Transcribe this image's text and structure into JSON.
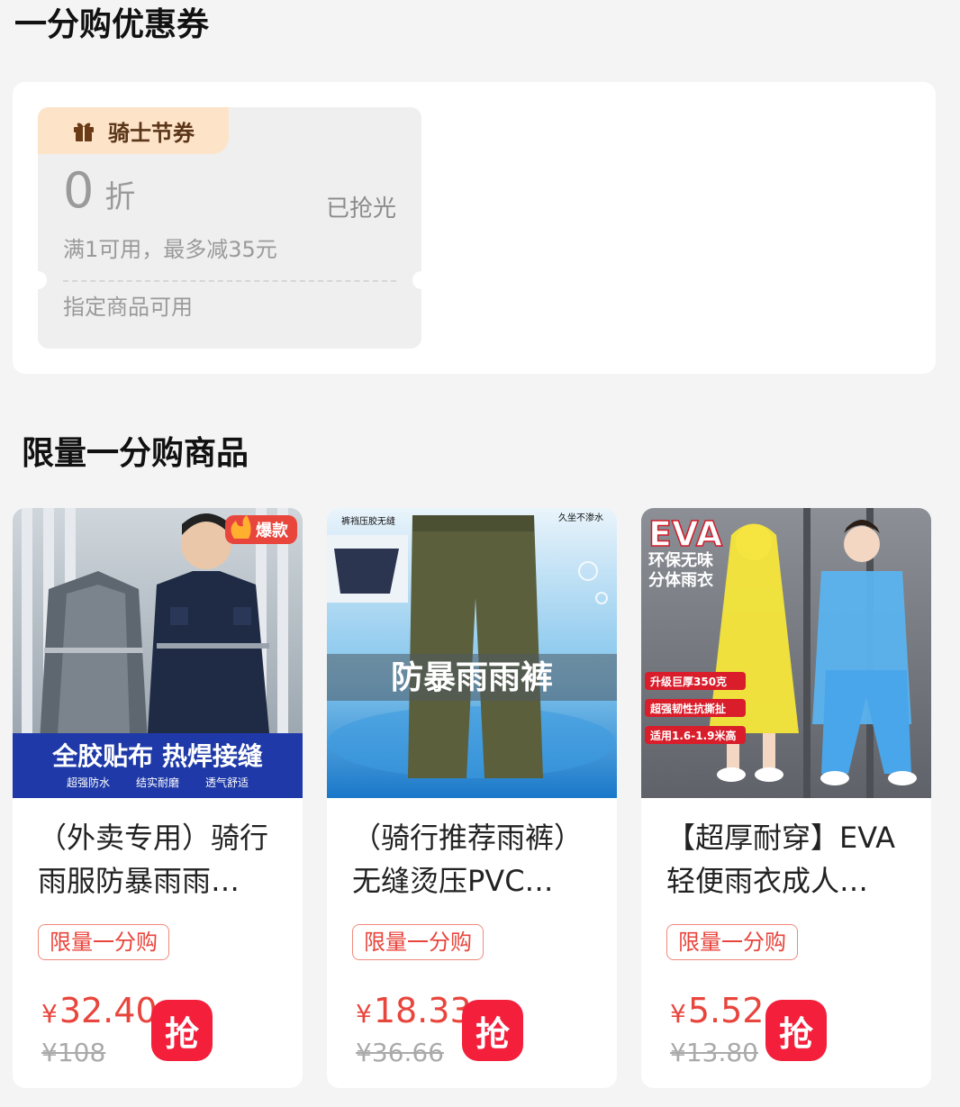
{
  "coupon_section": {
    "title": "一分购优惠券",
    "coupon": {
      "tag": "骑士节券",
      "discount_value": "0",
      "discount_unit": "折",
      "status": "已抢光",
      "condition": "满1可用，最多减35元",
      "scope": "指定商品可用"
    }
  },
  "goods_section": {
    "title": "限量一分购商品",
    "products": [
      {
        "name_line1": "（外卖专用）骑行",
        "name_line2": "雨服防暴雨雨…",
        "badge": "限量一分购",
        "price_symbol": "¥",
        "price": "32.40",
        "original_price": "¥108",
        "grab_label": "抢",
        "image": {
          "hot_label": "爆款",
          "banner": "全胶贴布 热焊接缝",
          "features": [
            "超强防水",
            "结实耐磨",
            "透气舒适"
          ]
        }
      },
      {
        "name_line1": "（骑行推荐雨裤）",
        "name_line2": "无缝烫压PVC…",
        "badge": "限量一分购",
        "price_symbol": "¥",
        "price": "18.33",
        "original_price": "¥36.66",
        "grab_label": "抢",
        "image": {
          "top_left": "裤裆压胶无缝",
          "top_right": "久坐不渗水",
          "banner": "防暴雨雨裤"
        }
      },
      {
        "name_line1": "【超厚耐穿】EVA",
        "name_line2": "轻便雨衣成人…",
        "badge": "限量一分购",
        "price_symbol": "¥",
        "price": "5.52",
        "original_price": "¥13.80",
        "grab_label": "抢",
        "image": {
          "brand": "EVA",
          "slogan1": "环保无味",
          "slogan2": "分体雨衣",
          "features": [
            "升级巨厚350克",
            "超强韧性抗撕扯",
            "适用1.6-1.9米高"
          ]
        }
      }
    ]
  },
  "colors": {
    "accent_red": "#e8453c",
    "grab_button": "#f31f3b",
    "coupon_tag_bg": "#fde3c8"
  }
}
